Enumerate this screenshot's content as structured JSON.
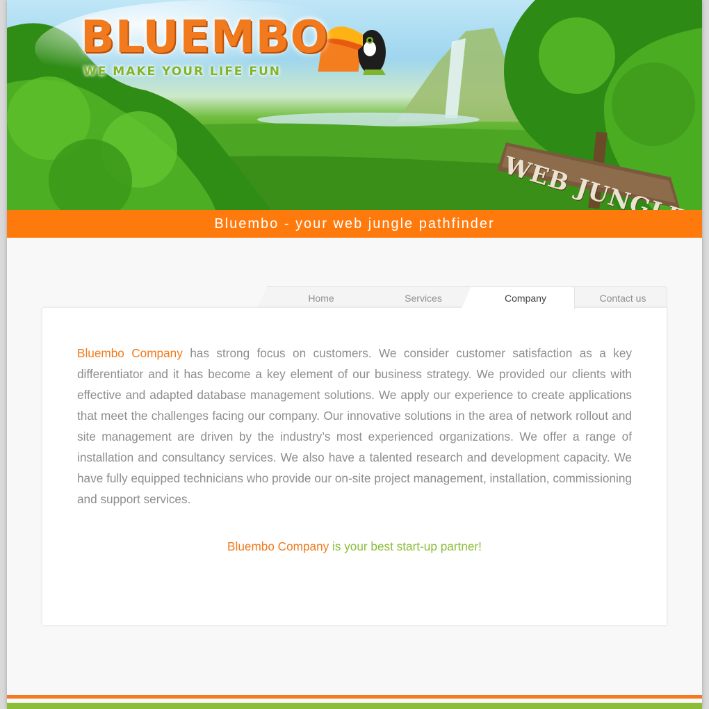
{
  "brand": {
    "name": "BLUEMBO",
    "tagline": "WE MAKE YOUR LIFE FUN",
    "sign": "WEB JUNGLE"
  },
  "header": {
    "slogan": "Bluembo - your web jungle pathfinder"
  },
  "nav": {
    "tabs": [
      {
        "label": "Home",
        "active": false
      },
      {
        "label": "Services",
        "active": false
      },
      {
        "label": "Company",
        "active": true
      },
      {
        "label": "Contact us",
        "active": false
      }
    ]
  },
  "content": {
    "company_name": "Bluembo Company",
    "paragraph": "has strong focus on customers. We consider customer satisfaction as a key differentiator and it has become a key element of our business strategy. We provided our clients with effective and adapted database management solutions. We apply our experience to create applications that meet the challenges facing our company. Our innovative solutions in the area of network rollout and site management are driven by the industry’s most experienced organizations. We offer a range of installation and consultancy services. We also have a talented research and development capacity. We have fully equipped technicians who provide our on-site project management, installation, commissioning and support services.",
    "tagline_name": "Bluembo Company",
    "tagline_rest": "is your best start-up partner!"
  },
  "colors": {
    "orange": "#ff7a0d",
    "green": "#8bbd3a",
    "text": "#8d8d8d"
  }
}
